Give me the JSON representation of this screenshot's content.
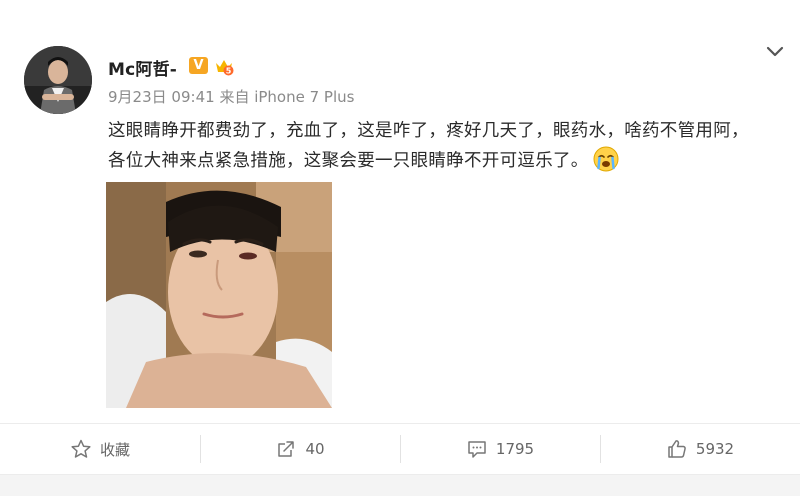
{
  "post": {
    "author": {
      "name": "Mc阿哲-",
      "verified_badge": "V",
      "level_badge": "crown-icon",
      "avatar": "avatar-image"
    },
    "meta": {
      "date": "9月23日",
      "time": "09:41",
      "source": "来自 iPhone 7 Plus"
    },
    "text": "这眼睛睁开都费劲了，充血了，这是咋了，疼好几天了，眼药水，啥药不管用阿，各位大神来点紧急措施，这聚会要一只眼睛睁不开可逗乐了。",
    "emoji": "crying-face-emoji",
    "photo": "selfie-photo",
    "menu_icon": "chevron-down-icon"
  },
  "actions": [
    {
      "icon": "star-icon",
      "label": "收藏"
    },
    {
      "icon": "share-icon",
      "label": "40"
    },
    {
      "icon": "comment-icon",
      "label": "1795"
    },
    {
      "icon": "thumbs-up-icon",
      "label": "5932"
    }
  ],
  "colors": {
    "verified": "#f6a623",
    "text": "#2b2b2b",
    "meta": "#8a8a8a"
  }
}
